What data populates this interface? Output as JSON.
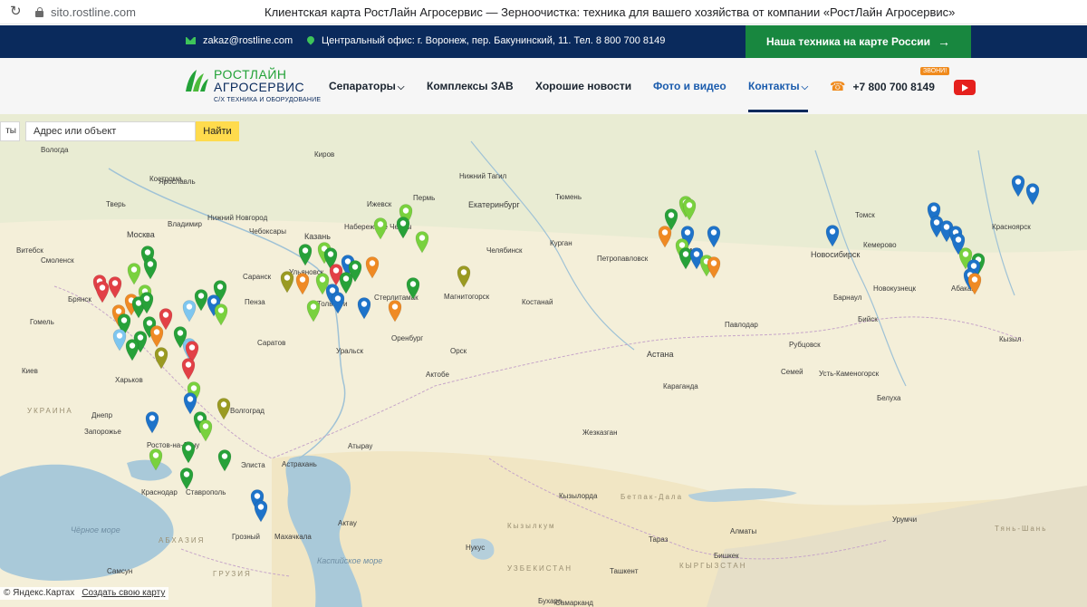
{
  "browser": {
    "url": "sito.rostline.com",
    "title": "Клиентская карта РостЛайн Агросервис — Зерноочистка: техника для вашего хозяйства от компании «РостЛайн Агросервис»"
  },
  "topbar": {
    "email": "zakaz@rostline.com",
    "office": "Центральный офис: г. Воронеж, пер. Бакунинский, 11. Тел. 8 800 700 8149",
    "cta": "Наша техника на карте России",
    "cta_color": "#18873f",
    "bar_color": "#0a2a5c"
  },
  "header": {
    "logo": {
      "line1": "РОСТЛАЙН",
      "line2": "АГРОСЕРВИС",
      "line3": "С/Х ТЕХНИКА И ОБОРУДОВАНИЕ"
    },
    "nav": [
      "Сепараторы",
      "Комплексы ЗАВ",
      "Хорошие новости",
      "Фото и видео",
      "Контакты"
    ],
    "phone": "+7 800 700 8149",
    "badge": "ЗВОНИ!",
    "youtube_icon": "youtube-icon"
  },
  "map": {
    "search_placeholder": "Адрес или объект",
    "search_button": "Найти",
    "layers_label": "ты",
    "copyright": "© Яндекс.Картах",
    "create_link": "Создать свою карту",
    "cities": [
      "Вологда",
      "Кострома",
      "Киров",
      "Нижний Тагил",
      "Екатеринбург",
      "Тюмень",
      "Ижевск",
      "Набережные Челны",
      "Пермь",
      "Ярославль",
      "Тверь",
      "Владимир",
      "Нижний Новгород",
      "Чебоксары",
      "Москва",
      "Казань",
      "Витебск",
      "Смоленск",
      "Ульяновск",
      "Челябинск",
      "Курган",
      "Петропавловск",
      "Омск",
      "Новосибирск",
      "Томск",
      "Красноярск",
      "Кемерово",
      "Новокузнецк",
      "Абакан",
      "Барнаул",
      "Бийск",
      "Рубцовск",
      "Павлодар",
      "Семей",
      "Усть-Каменогорск",
      "Белуха",
      "Кызыл",
      "Брянск",
      "Гомель",
      "Пенза",
      "Саранск",
      "Тольятти",
      "Стерлитамак",
      "Оренбург",
      "Уральск",
      "Орск",
      "Магнитогорск",
      "Костанай",
      "Актобе",
      "Астана",
      "Караганда",
      "Жезказган",
      "Саратов",
      "Волгоград",
      "Харьков",
      "Киев",
      "Днепр",
      "Запорожье",
      "Ростов-на-Дону",
      "Краснодар",
      "Ставрополь",
      "Элиста",
      "Астрахань",
      "Атырау",
      "Грозный",
      "Махачкала",
      "Актау",
      "Самсун",
      "Кызылорда",
      "Нукус",
      "Тараз",
      "Бишкек",
      "Алматы",
      "Урумчи",
      "Ташкент",
      "Самарканд",
      "Бухара"
    ],
    "regions": [
      "УКРАИНА",
      "Бетпак-Дала",
      "Кызылкум",
      "УЗБЕКИСТАН",
      "КЫРГЫЗСТАН",
      "АБХАЗИЯ",
      "ГРУЗИЯ",
      "Тянь-Шань"
    ],
    "seas": [
      "Чёрное море",
      "Каспийское море"
    ],
    "pin_colors": {
      "green": "#27a139",
      "lightgreen": "#79d13e",
      "blue": "#1e73c9",
      "lightblue": "#7ec6ef",
      "orange": "#ef8a24",
      "red": "#e24046",
      "olive": "#9a9a22"
    },
    "marker_counts": {
      "green": 40,
      "blue": 27,
      "orange": 9,
      "red": 6,
      "olive": 5,
      "lightblue": 3
    }
  }
}
